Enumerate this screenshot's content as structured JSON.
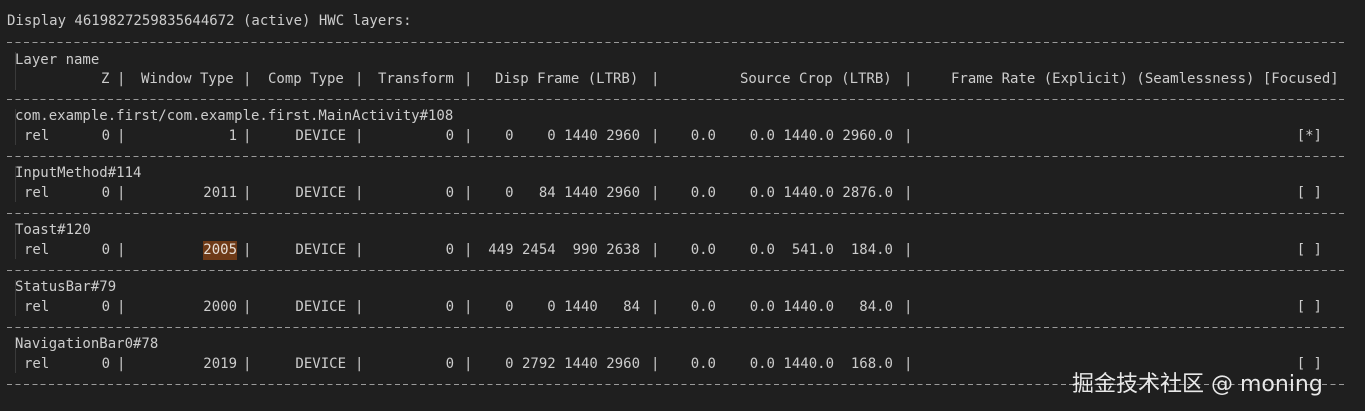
{
  "title": "Display 4619827259835644672 (active) HWC layers:",
  "header": {
    "layer_name": "Layer name",
    "z": "Z",
    "window_type": "Window Type",
    "comp_type": "Comp Type",
    "transform": "Transform",
    "disp_frame": "Disp Frame (LTRB)",
    "source_crop": "Source Crop (LTRB)",
    "frame_rate": "Frame Rate (Explicit) (Seamlessness) [Focused]"
  },
  "layers": [
    {
      "name": "com.example.first/com.example.first.MainActivity#108",
      "rel": "rel",
      "z": "0",
      "window_type": "1",
      "comp_type": "DEVICE",
      "transform": "0",
      "disp_frame": [
        "0",
        "0",
        "1440",
        "2960"
      ],
      "source_crop": [
        "0.0",
        "0.0",
        "1440.0",
        "2960.0"
      ],
      "focused": "[*]",
      "highlight": false
    },
    {
      "name": "InputMethod#114",
      "rel": "rel",
      "z": "0",
      "window_type": "2011",
      "comp_type": "DEVICE",
      "transform": "0",
      "disp_frame": [
        "0",
        "84",
        "1440",
        "2960"
      ],
      "source_crop": [
        "0.0",
        "0.0",
        "1440.0",
        "2876.0"
      ],
      "focused": "[ ]",
      "highlight": false
    },
    {
      "name": "Toast#120",
      "rel": "rel",
      "z": "0",
      "window_type": "2005",
      "comp_type": "DEVICE",
      "transform": "0",
      "disp_frame": [
        "449",
        "2454",
        "990",
        "2638"
      ],
      "source_crop": [
        "0.0",
        "0.0",
        "541.0",
        "184.0"
      ],
      "focused": "[ ]",
      "highlight": true
    },
    {
      "name": "StatusBar#79",
      "rel": "rel",
      "z": "0",
      "window_type": "2000",
      "comp_type": "DEVICE",
      "transform": "0",
      "disp_frame": [
        "0",
        "0",
        "1440",
        "84"
      ],
      "source_crop": [
        "0.0",
        "0.0",
        "1440.0",
        "84.0"
      ],
      "focused": "[ ]",
      "highlight": false
    },
    {
      "name": "NavigationBar0#78",
      "rel": "rel",
      "z": "0",
      "window_type": "2019",
      "comp_type": "DEVICE",
      "transform": "0",
      "disp_frame": [
        "0",
        "2792",
        "1440",
        "2960"
      ],
      "source_crop": [
        "0.0",
        "0.0",
        "1440.0",
        "168.0"
      ],
      "focused": "[ ]",
      "highlight": false
    }
  ],
  "pipe": "|",
  "watermark": "掘金技术社区 @ moning"
}
